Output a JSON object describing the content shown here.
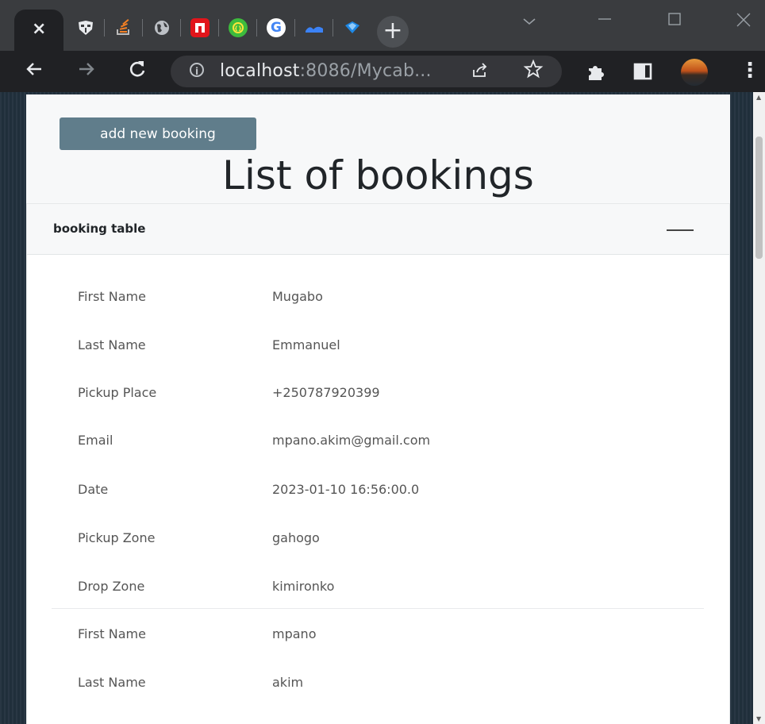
{
  "browser": {
    "tabs": [
      {
        "icon": "close-icon",
        "label": "×"
      },
      {
        "icon": "mask-icon"
      },
      {
        "icon": "stackoverflow-icon"
      },
      {
        "icon": "globe-icon"
      },
      {
        "icon": "red-square-icon"
      },
      {
        "icon": "green-circle-icon"
      },
      {
        "icon": "google-icon",
        "label": "G"
      },
      {
        "icon": "blue-wave-icon"
      },
      {
        "icon": "blue-shield-icon"
      }
    ],
    "new_tab_label": "+",
    "url_host": "localhost",
    "url_rest": ":8086/Mycab...",
    "info_glyph": "i"
  },
  "page": {
    "add_button_label": "add new booking",
    "title": "List of bookings",
    "card_title": "booking table",
    "bookings": [
      {
        "rows": [
          {
            "label": "First Name",
            "value": "Mugabo"
          },
          {
            "label": "Last Name",
            "value": "Emmanuel"
          },
          {
            "label": "Pickup Place",
            "value": "+250787920399"
          },
          {
            "label": "Email",
            "value": "mpano.akim@gmail.com"
          },
          {
            "label": "Date",
            "value": "2023-01-10 16:56:00.0"
          },
          {
            "label": "Pickup Zone",
            "value": "gahogo"
          },
          {
            "label": "Drop Zone",
            "value": "kimironko"
          }
        ]
      },
      {
        "rows": [
          {
            "label": "First Name",
            "value": "mpano"
          },
          {
            "label": "Last Name",
            "value": "akim"
          }
        ]
      }
    ]
  },
  "colors": {
    "button_bg": "#607d8b",
    "chrome_dark": "#202124",
    "chrome_tabstrip": "#3a3c3f"
  }
}
